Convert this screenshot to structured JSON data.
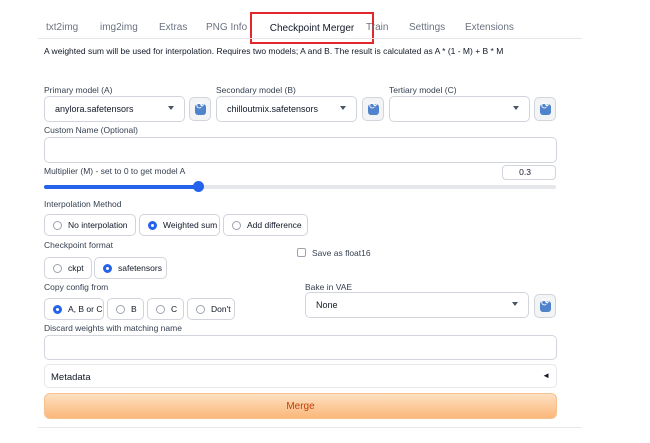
{
  "tabs": [
    {
      "label": "txt2img"
    },
    {
      "label": "img2img"
    },
    {
      "label": "Extras"
    },
    {
      "label": "PNG Info"
    },
    {
      "label": "Checkpoint Merger"
    },
    {
      "label": "Train"
    },
    {
      "label": "Settings"
    },
    {
      "label": "Extensions"
    }
  ],
  "active_tab": "Checkpoint Merger",
  "highlight_color": "#e3262b",
  "description": "A weighted sum will be used for interpolation. Requires two models; A and B. The result is calculated as A * (1 - M) + B * M",
  "models": {
    "primary": {
      "label": "Primary model (A)",
      "value": "anylora.safetensors"
    },
    "secondary": {
      "label": "Secondary model (B)",
      "value": "chilloutmix.safetensors"
    },
    "tertiary": {
      "label": "Tertiary model (C)",
      "value": ""
    }
  },
  "custom_name": {
    "label": "Custom Name (Optional)",
    "value": ""
  },
  "multiplier": {
    "label": "Multiplier (M) - set to 0 to get model A",
    "value": "0.3",
    "fraction": 0.3
  },
  "interpolation": {
    "label": "Interpolation Method",
    "options": [
      "No interpolation",
      "Weighted sum",
      "Add difference"
    ],
    "selected": "Weighted sum"
  },
  "checkpoint_format": {
    "label": "Checkpoint format",
    "options": [
      "ckpt",
      "safetensors"
    ],
    "selected": "safetensors"
  },
  "float16": {
    "label": "Save as float16",
    "checked": false
  },
  "copy_config": {
    "label": "Copy config from",
    "options": [
      "A, B or C",
      "B",
      "C",
      "Don't"
    ],
    "selected": "A, B or C"
  },
  "bake_vae": {
    "label": "Bake in VAE",
    "value": "None"
  },
  "discard_weights": {
    "label": "Discard weights with matching name",
    "value": ""
  },
  "metadata": {
    "label": "Metadata",
    "arrow": "◄"
  },
  "merge_button": {
    "label": "Merge"
  },
  "accent_color": "#2563eb",
  "merge_color": "#fbb77a"
}
